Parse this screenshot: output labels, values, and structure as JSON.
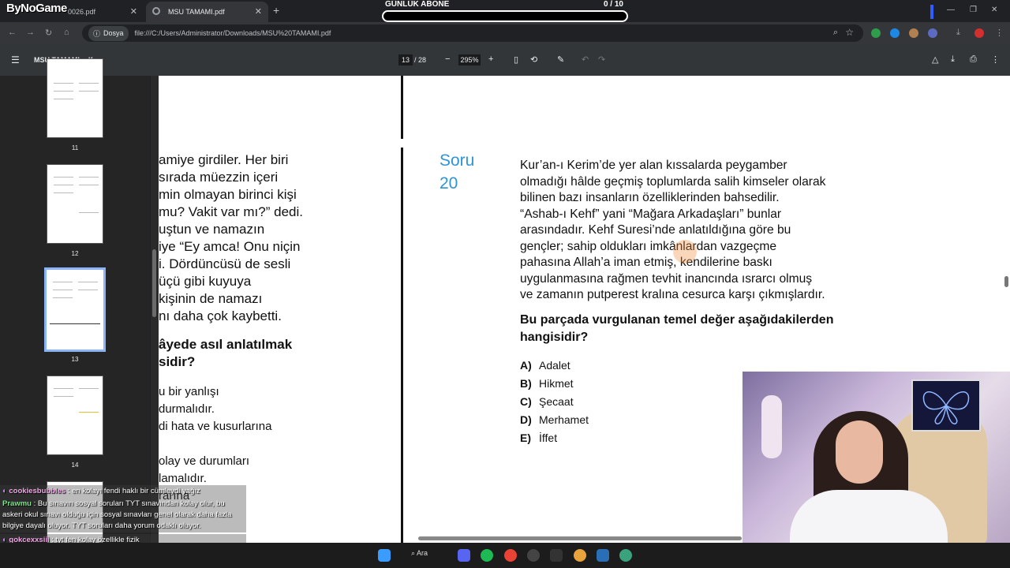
{
  "browser": {
    "logo_text": "ByNoGame",
    "tabs": [
      {
        "label": "0026.pdf"
      },
      {
        "label": "MSU TAMAMI.pdf"
      }
    ],
    "address": {
      "chip": "Dosya",
      "url": "file:///C:/Users/Administrator/Downloads/MSU%20TAMAMI.pdf"
    }
  },
  "subscriber_widget": {
    "title": "GÜNLÜK ABONE",
    "count": "0   / 10",
    "progress_fraction": 0.0
  },
  "pdf_toolbar": {
    "filename": "MSU TAMAMI.pdf",
    "current_page": "13",
    "total_pages": "/ 28",
    "zoom": "295%"
  },
  "thumbnails": [
    {
      "number": "11"
    },
    {
      "number": "12"
    },
    {
      "number": "13"
    },
    {
      "number": "14"
    }
  ],
  "left_column": {
    "lines": [
      "amiye girdiler. Her biri",
      " sırada müezzin içeri",
      "min olmayan birinci kişi",
      "mu? Vakit var mı?” dedi.",
      "uştun ve namazın",
      "iye “Ey amca! Onu niçin",
      "i. Dördüncüsü de sesli",
      " üçü gibi kuyuya",
      "kişinin de namazı",
      "nı daha çok kaybetti."
    ],
    "bold_lines": [
      "âyede asıl anlatılmak",
      "sidir?"
    ],
    "option_lines": [
      "u bir yanlışı",
      "durmalıdır.",
      "di hata ve kusurlarına",
      "",
      " olay ve durumları",
      "lamalıdır.",
      "rarına"
    ]
  },
  "question": {
    "label_line1": "Soru",
    "label_line2": "20",
    "text_lines": [
      "Kur’an-ı Kerim’de yer alan kıssalarda peygamber",
      "olmadığı hâlde geçmiş toplumlarda salih kimseler olarak",
      "bilinen bazı insanların özelliklerinden bahsedilir.",
      "“Ashab-ı Kehf” yani “Mağara Arkadaşları” bunlar",
      "arasındadır. Kehf Suresi’nde anlatıldığına göre bu",
      "gençler; sahip oldukları imkânlardan vazgeçme",
      "pahasına Allah’a iman etmiş, kendilerine baskı",
      "uygulanmasına rağmen tevhit inancında ısrarcı olmuş",
      "ve zamanın putperest kralına cesurca karşı çıkmışlardır."
    ],
    "prompt_line1": "Bu parçada vurgulanan temel değer aşağıdakilerden",
    "prompt_line2": "hangisidir?",
    "options": [
      {
        "letter": "A)",
        "text": "Adalet"
      },
      {
        "letter": "B)",
        "text": "Hikmet"
      },
      {
        "letter": "C)",
        "text": "Şecaat"
      },
      {
        "letter": "D)",
        "text": "Merhamet"
      },
      {
        "letter": "E)",
        "text": "İffet"
      }
    ]
  },
  "chat": [
    {
      "user": "cookiesbubbles",
      "text": " : en kolayı fendi haklı bir cümleydi yağız",
      "color": "#f4a6e8"
    },
    {
      "user": "Prawmu",
      "text": " : Bu sınavın sosyal soruları TYT sınavından kolay olur, bu askeri okul sınavı olduğu için sosyal sınavları genel olarak daha fazla bilgiye dayalı oluyor. TYT soruları daha yorum odaklı oluyor.",
      "color": "#7ee08a"
    },
    {
      "user": "gokcexxsiii",
      "text": " : tyt fen kolay özellikle fizik",
      "color": "#f4a6e8"
    }
  ],
  "taskbar": {
    "search_label": "Ara"
  }
}
